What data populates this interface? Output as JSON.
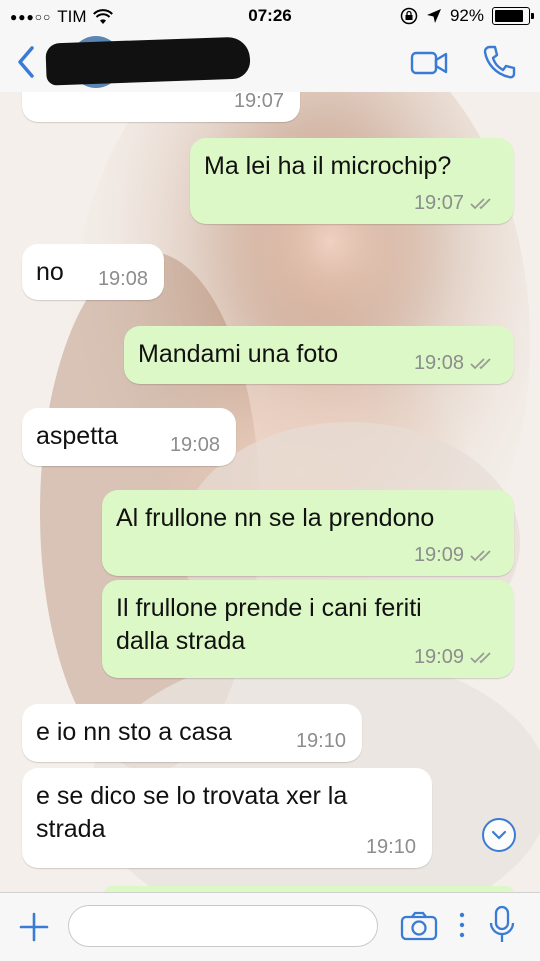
{
  "status_bar": {
    "carrier": "TIM",
    "time": "07:26",
    "battery_label": "92%",
    "battery_level": 0.92
  },
  "nav": {
    "icons": [
      "back-chevron-icon",
      "video-camera-icon",
      "phone-icon"
    ]
  },
  "colors": {
    "accent": "#3a7bd5",
    "outgoing_bubble": "#dcf8c6",
    "incoming_bubble": "#ffffff"
  },
  "messages": [
    {
      "direction": "in",
      "text": "",
      "time": "19:07"
    },
    {
      "direction": "out",
      "text": "Ma lei ha il microchip?",
      "time": "19:07",
      "read": true
    },
    {
      "direction": "in",
      "text": "no",
      "time": "19:08"
    },
    {
      "direction": "out",
      "text": "Mandami una foto",
      "time": "19:08",
      "read": true
    },
    {
      "direction": "in",
      "text": "aspetta",
      "time": "19:08"
    },
    {
      "direction": "out",
      "text": "Al frullone nn se la prendono",
      "time": "19:09",
      "read": true
    },
    {
      "direction": "out",
      "text": "Il frullone prende i cani feriti\ndalla strada",
      "time": "19:09",
      "read": true
    },
    {
      "direction": "in",
      "text": "e io nn sto a casa",
      "time": "19:10"
    },
    {
      "direction": "in",
      "text": "e se dico se lo trovata xer la\nstrada",
      "time": "19:10"
    }
  ],
  "composer": {
    "input_value": "",
    "icons": [
      "plus-icon",
      "camera-icon",
      "microphone-icon"
    ]
  }
}
